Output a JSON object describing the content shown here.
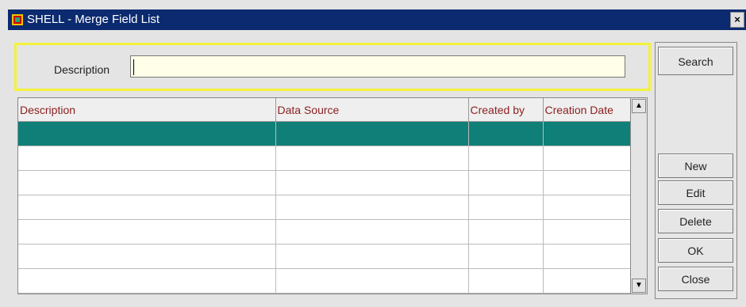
{
  "window": {
    "title": "SHELL - Merge Field List",
    "close_glyph": "×"
  },
  "search": {
    "label": "Description",
    "value": ""
  },
  "buttons": {
    "search": "Search",
    "new": "New",
    "edit": "Edit",
    "delete": "Delete",
    "ok": "OK",
    "close": "Close"
  },
  "table": {
    "columns": [
      "Description",
      "Data Source",
      "Created by",
      "Creation Date"
    ],
    "rows": [
      [
        "",
        "",
        "",
        ""
      ],
      [
        "",
        "",
        "",
        ""
      ],
      [
        "",
        "",
        "",
        ""
      ],
      [
        "",
        "",
        "",
        ""
      ],
      [
        "",
        "",
        "",
        ""
      ],
      [
        "",
        "",
        "",
        ""
      ],
      [
        "",
        "",
        "",
        ""
      ]
    ],
    "selected_row_index": 0
  },
  "colors": {
    "title_bar": "#0b2a6f",
    "highlight_border": "#f2f23a",
    "input_bg": "#fffee8",
    "header_text": "#8b1e1e",
    "selected_row": "#0f7f77"
  },
  "icons": {
    "app": "app-icon",
    "scroll_up": "scroll-up-arrow-icon",
    "scroll_down": "scroll-down-arrow-icon"
  }
}
